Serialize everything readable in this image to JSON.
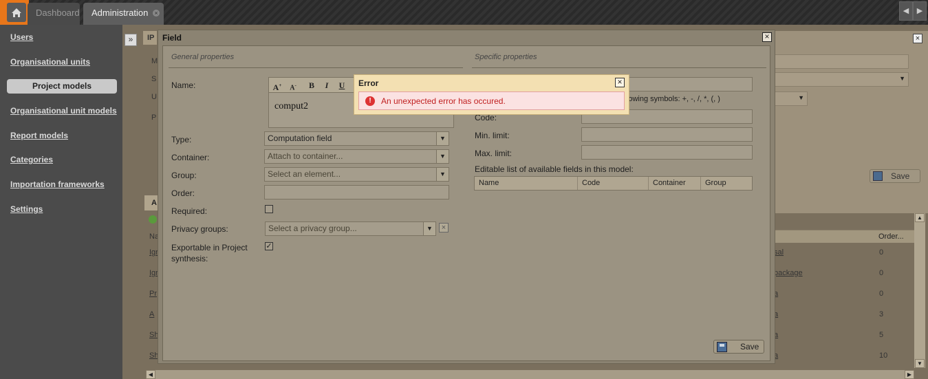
{
  "tabs": [
    {
      "label": "Dashboard"
    },
    {
      "label": "Administration"
    }
  ],
  "sidebar": {
    "items": [
      {
        "label": "Users"
      },
      {
        "label": "Organisational units"
      },
      {
        "label": "Project models"
      },
      {
        "label": "Organisational unit models"
      },
      {
        "label": "Report models"
      },
      {
        "label": "Categories"
      },
      {
        "label": "Importation frameworks"
      },
      {
        "label": "Settings"
      }
    ]
  },
  "background": {
    "panel_header": "IP",
    "form_initials": [
      "M",
      "S",
      "U",
      "P"
    ],
    "symbols_note": "he following symbols: +, -, /, *, (, )",
    "save_label": "Save",
    "table_header_order": "Order...",
    "table_header_name": "Na",
    "row_links_left": [
      "Igr",
      "Igr",
      "Pr",
      "A",
      "Sh",
      "Sh"
    ],
    "row_links_right": [
      "sal",
      "package",
      "a",
      "a",
      "a",
      "a"
    ],
    "row_orders": [
      "0",
      "0",
      "0",
      "3",
      "5",
      "10"
    ],
    "tab_letter": "A"
  },
  "field_dialog": {
    "title": "Field",
    "general_title": "General properties",
    "specific_title": "Specific properties",
    "name_label": "Name:",
    "name_value": "comput2",
    "type_label": "Type:",
    "type_value": "Computation field",
    "container_label": "Container:",
    "container_placeholder": "Attach to container...",
    "group_label": "Group:",
    "group_placeholder": "Select an element...",
    "order_label": "Order:",
    "required_label": "Required:",
    "privacy_label": "Privacy groups:",
    "privacy_placeholder": "Select a privacy group...",
    "exportable_label_1": "Exportable in Project",
    "exportable_label_2": "synthesis:",
    "code_label": "Code:",
    "min_label": "Min. limit:",
    "max_label": "Max. limit:",
    "fields_list_label": "Editable list of available fields in this model:",
    "table_headers": [
      "Name",
      "Code",
      "Container",
      "Group"
    ],
    "save_label": "Save",
    "required_checked": false,
    "exportable_checked": true
  },
  "error_dialog": {
    "title": "Error",
    "message": "An unexpected error has occured.",
    "icon": "error-icon"
  },
  "colors": {
    "accent": "#e8761a",
    "error_text": "#c02020",
    "error_bg": "#fbe2e2"
  }
}
